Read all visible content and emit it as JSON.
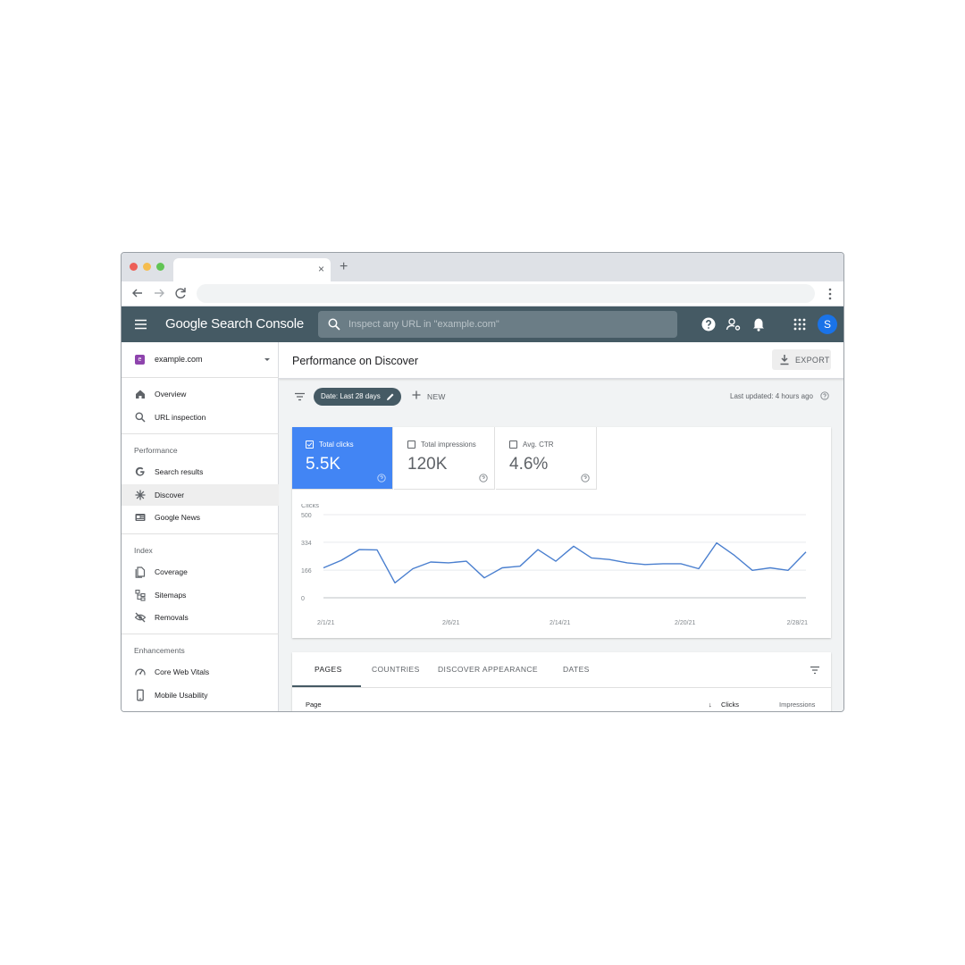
{
  "app": {
    "brand": "Google Search Console",
    "search_placeholder": "Inspect any URL in \"example.com\"",
    "avatar_initial": "S",
    "accent": "#4285f4",
    "appbar_color": "#455a64"
  },
  "browser": {
    "tab_close": "×",
    "new_tab": "+"
  },
  "property": {
    "badge": "e",
    "name": "example.com"
  },
  "sidebar": {
    "top_items": [
      {
        "label": "Overview",
        "icon": "home-icon"
      },
      {
        "label": "URL inspection",
        "icon": "search-icon"
      }
    ],
    "performance_title": "Performance",
    "performance_items": [
      {
        "label": "Search results",
        "icon": "google-g-icon"
      },
      {
        "label": "Discover",
        "icon": "discover-asterisk-icon",
        "active": true
      },
      {
        "label": "Google News",
        "icon": "news-icon"
      }
    ],
    "index_title": "Index",
    "index_items": [
      {
        "label": "Coverage",
        "icon": "coverage-icon"
      },
      {
        "label": "Sitemaps",
        "icon": "sitemap-icon"
      },
      {
        "label": "Removals",
        "icon": "eye-off-icon"
      }
    ],
    "enhancements_title": "Enhancements",
    "enhancements_items": [
      {
        "label": "Core Web Vitals",
        "icon": "gauge-icon"
      },
      {
        "label": "Mobile Usability",
        "icon": "phone-icon"
      }
    ]
  },
  "header": {
    "title": "Performance on Discover",
    "export_label": "EXPORT"
  },
  "filters": {
    "date_chip": "Date: Last 28 days",
    "new_label": "NEW",
    "last_updated": "Last updated: 4 hours ago"
  },
  "metrics": [
    {
      "label": "Total clicks",
      "value": "5.5K",
      "selected": true
    },
    {
      "label": "Total impressions",
      "value": "120K",
      "selected": false
    },
    {
      "label": "Avg. CTR",
      "value": "4.6%",
      "selected": false
    }
  ],
  "chart_data": {
    "type": "line",
    "ylabel": "Clicks",
    "y_ticks": [
      "500",
      "334",
      "166",
      "0"
    ],
    "y_tick_values": [
      500,
      334,
      166,
      0
    ],
    "ylim": [
      0,
      500
    ],
    "x_tick_labels": [
      "2/1/21",
      "2/6/21",
      "2/14/21",
      "2/20/21",
      "2/28/21"
    ],
    "x_tick_index": [
      0,
      7,
      13,
      20,
      27
    ],
    "grid": true,
    "line_color": "#4a7fcf",
    "values": [
      180,
      225,
      290,
      288,
      90,
      175,
      215,
      210,
      220,
      120,
      180,
      190,
      290,
      220,
      310,
      240,
      230,
      210,
      200,
      205,
      205,
      175,
      330,
      255,
      165,
      180,
      165,
      275
    ]
  },
  "table": {
    "tabs": [
      "PAGES",
      "COUNTRIES",
      "DISCOVER APPEARANCE",
      "DATES"
    ],
    "active_tab": 0,
    "columns": [
      "Page",
      "Clicks",
      "Impressions"
    ],
    "sort_arrow": "↓"
  }
}
